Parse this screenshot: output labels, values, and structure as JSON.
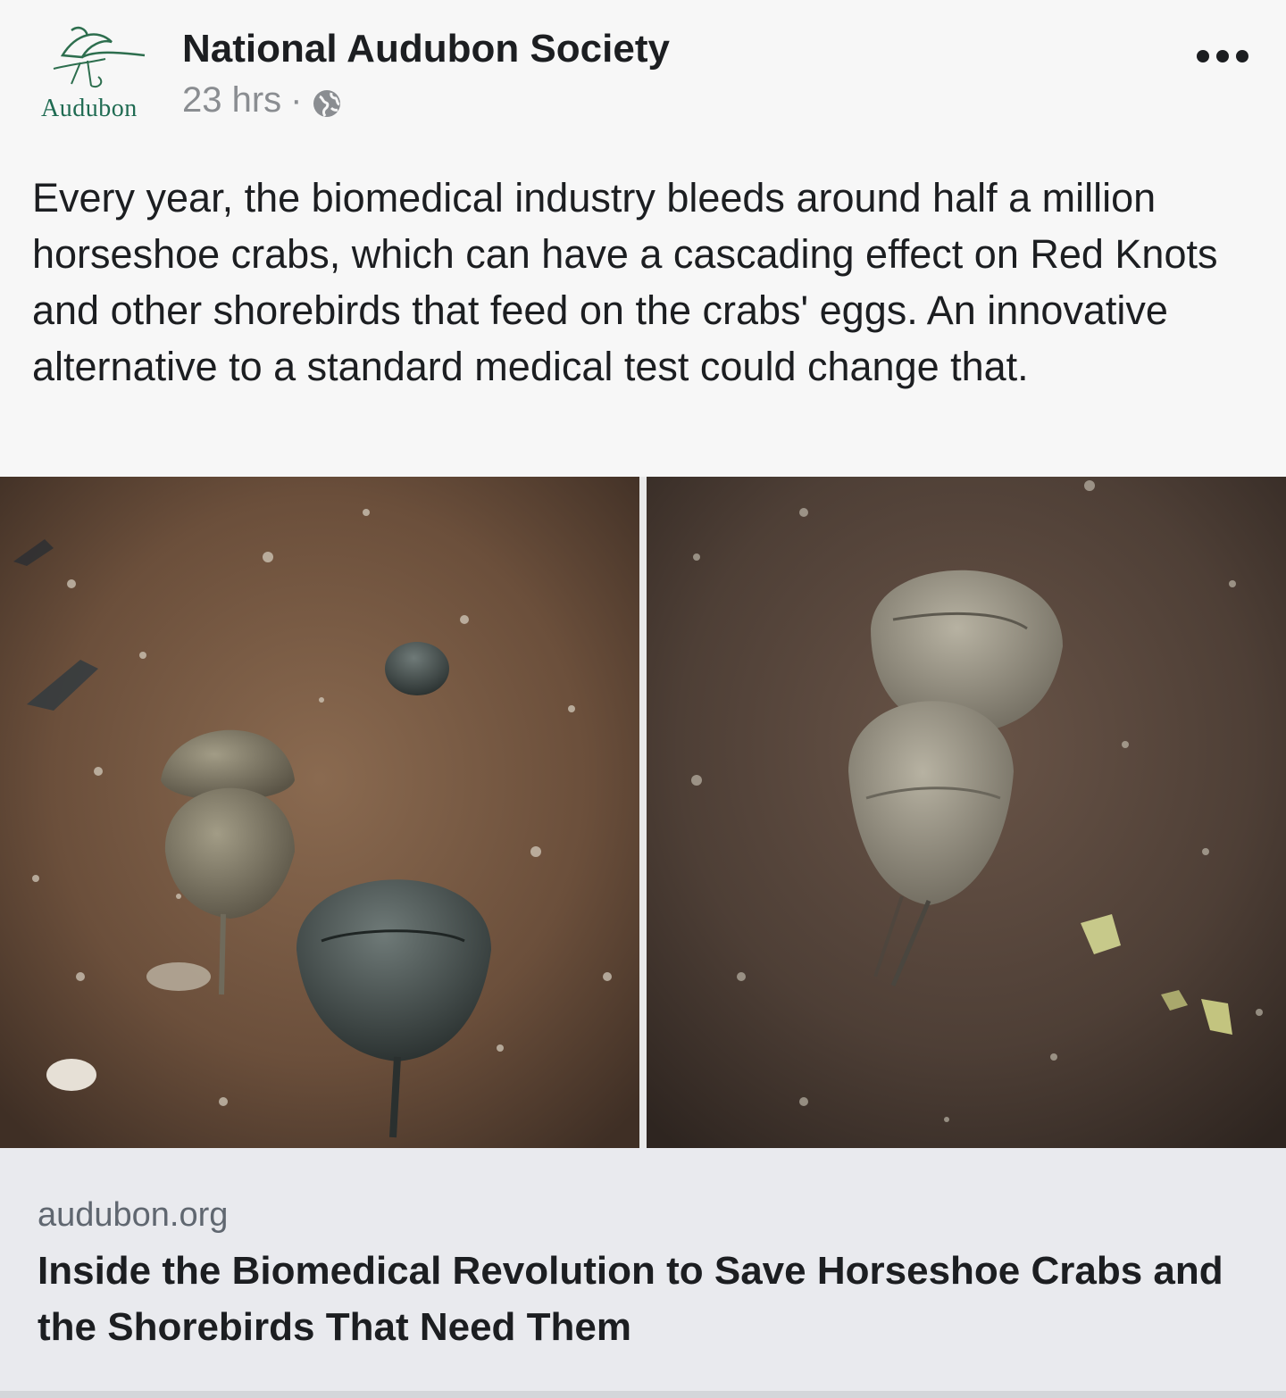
{
  "post": {
    "page_name": "National Audubon Society",
    "logo_text": "Audubon",
    "timestamp": "23 hrs",
    "separator": "·",
    "privacy_icon": "globe-icon",
    "more_icon": "more-options-icon",
    "caption": "Every year, the biomedical industry bleeds around half a million horseshoe crabs, which can have a cascading effect on Red Knots and other shorebirds that feed on the crabs' eggs. An innovative alternative to a standard medical test could change that."
  },
  "link_preview": {
    "domain": "audubon.org",
    "title": "Inside the Biomedical Revolution to Save Horseshoe Crabs and the Shorebirds That Need Them"
  },
  "colors": {
    "background": "#f7f7f7",
    "card_background": "#e9eaee",
    "text_primary": "#1c1e21",
    "text_secondary": "#8a8d91",
    "logo_green": "#1f6b52"
  }
}
